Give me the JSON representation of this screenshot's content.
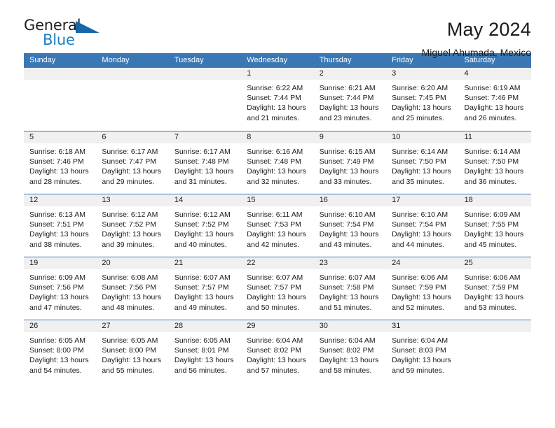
{
  "brand": {
    "word_one": "General",
    "word_two": "Blue",
    "triangle_icon": "triangle-icon"
  },
  "header": {
    "title": "May 2024",
    "subtitle": "Miguel Ahumada, Mexico"
  },
  "theme": {
    "accent": "#3a78b5",
    "brand_blue": "#1b7fc4",
    "daynum_bg": "#f0f0f0",
    "text": "#1a1a1a"
  },
  "weekday_headers": [
    "Sunday",
    "Monday",
    "Tuesday",
    "Wednesday",
    "Thursday",
    "Friday",
    "Saturday"
  ],
  "labels": {
    "sunrise_prefix": "Sunrise:",
    "sunset_prefix": "Sunset:",
    "daylight_prefix": "Daylight:"
  },
  "weeks": [
    [
      {
        "day": "",
        "empty": true
      },
      {
        "day": "",
        "empty": true
      },
      {
        "day": "",
        "empty": true
      },
      {
        "day": "1",
        "sunrise": "Sunrise: 6:22 AM",
        "sunset": "Sunset: 7:44 PM",
        "daylight_line1": "Daylight: 13 hours",
        "daylight_line2": "and 21 minutes."
      },
      {
        "day": "2",
        "sunrise": "Sunrise: 6:21 AM",
        "sunset": "Sunset: 7:44 PM",
        "daylight_line1": "Daylight: 13 hours",
        "daylight_line2": "and 23 minutes."
      },
      {
        "day": "3",
        "sunrise": "Sunrise: 6:20 AM",
        "sunset": "Sunset: 7:45 PM",
        "daylight_line1": "Daylight: 13 hours",
        "daylight_line2": "and 25 minutes."
      },
      {
        "day": "4",
        "sunrise": "Sunrise: 6:19 AM",
        "sunset": "Sunset: 7:46 PM",
        "daylight_line1": "Daylight: 13 hours",
        "daylight_line2": "and 26 minutes."
      }
    ],
    [
      {
        "day": "5",
        "sunrise": "Sunrise: 6:18 AM",
        "sunset": "Sunset: 7:46 PM",
        "daylight_line1": "Daylight: 13 hours",
        "daylight_line2": "and 28 minutes."
      },
      {
        "day": "6",
        "sunrise": "Sunrise: 6:17 AM",
        "sunset": "Sunset: 7:47 PM",
        "daylight_line1": "Daylight: 13 hours",
        "daylight_line2": "and 29 minutes."
      },
      {
        "day": "7",
        "sunrise": "Sunrise: 6:17 AM",
        "sunset": "Sunset: 7:48 PM",
        "daylight_line1": "Daylight: 13 hours",
        "daylight_line2": "and 31 minutes."
      },
      {
        "day": "8",
        "sunrise": "Sunrise: 6:16 AM",
        "sunset": "Sunset: 7:48 PM",
        "daylight_line1": "Daylight: 13 hours",
        "daylight_line2": "and 32 minutes."
      },
      {
        "day": "9",
        "sunrise": "Sunrise: 6:15 AM",
        "sunset": "Sunset: 7:49 PM",
        "daylight_line1": "Daylight: 13 hours",
        "daylight_line2": "and 33 minutes."
      },
      {
        "day": "10",
        "sunrise": "Sunrise: 6:14 AM",
        "sunset": "Sunset: 7:50 PM",
        "daylight_line1": "Daylight: 13 hours",
        "daylight_line2": "and 35 minutes."
      },
      {
        "day": "11",
        "sunrise": "Sunrise: 6:14 AM",
        "sunset": "Sunset: 7:50 PM",
        "daylight_line1": "Daylight: 13 hours",
        "daylight_line2": "and 36 minutes."
      }
    ],
    [
      {
        "day": "12",
        "sunrise": "Sunrise: 6:13 AM",
        "sunset": "Sunset: 7:51 PM",
        "daylight_line1": "Daylight: 13 hours",
        "daylight_line2": "and 38 minutes."
      },
      {
        "day": "13",
        "sunrise": "Sunrise: 6:12 AM",
        "sunset": "Sunset: 7:52 PM",
        "daylight_line1": "Daylight: 13 hours",
        "daylight_line2": "and 39 minutes."
      },
      {
        "day": "14",
        "sunrise": "Sunrise: 6:12 AM",
        "sunset": "Sunset: 7:52 PM",
        "daylight_line1": "Daylight: 13 hours",
        "daylight_line2": "and 40 minutes."
      },
      {
        "day": "15",
        "sunrise": "Sunrise: 6:11 AM",
        "sunset": "Sunset: 7:53 PM",
        "daylight_line1": "Daylight: 13 hours",
        "daylight_line2": "and 42 minutes."
      },
      {
        "day": "16",
        "sunrise": "Sunrise: 6:10 AM",
        "sunset": "Sunset: 7:54 PM",
        "daylight_line1": "Daylight: 13 hours",
        "daylight_line2": "and 43 minutes."
      },
      {
        "day": "17",
        "sunrise": "Sunrise: 6:10 AM",
        "sunset": "Sunset: 7:54 PM",
        "daylight_line1": "Daylight: 13 hours",
        "daylight_line2": "and 44 minutes."
      },
      {
        "day": "18",
        "sunrise": "Sunrise: 6:09 AM",
        "sunset": "Sunset: 7:55 PM",
        "daylight_line1": "Daylight: 13 hours",
        "daylight_line2": "and 45 minutes."
      }
    ],
    [
      {
        "day": "19",
        "sunrise": "Sunrise: 6:09 AM",
        "sunset": "Sunset: 7:56 PM",
        "daylight_line1": "Daylight: 13 hours",
        "daylight_line2": "and 47 minutes."
      },
      {
        "day": "20",
        "sunrise": "Sunrise: 6:08 AM",
        "sunset": "Sunset: 7:56 PM",
        "daylight_line1": "Daylight: 13 hours",
        "daylight_line2": "and 48 minutes."
      },
      {
        "day": "21",
        "sunrise": "Sunrise: 6:07 AM",
        "sunset": "Sunset: 7:57 PM",
        "daylight_line1": "Daylight: 13 hours",
        "daylight_line2": "and 49 minutes."
      },
      {
        "day": "22",
        "sunrise": "Sunrise: 6:07 AM",
        "sunset": "Sunset: 7:57 PM",
        "daylight_line1": "Daylight: 13 hours",
        "daylight_line2": "and 50 minutes."
      },
      {
        "day": "23",
        "sunrise": "Sunrise: 6:07 AM",
        "sunset": "Sunset: 7:58 PM",
        "daylight_line1": "Daylight: 13 hours",
        "daylight_line2": "and 51 minutes."
      },
      {
        "day": "24",
        "sunrise": "Sunrise: 6:06 AM",
        "sunset": "Sunset: 7:59 PM",
        "daylight_line1": "Daylight: 13 hours",
        "daylight_line2": "and 52 minutes."
      },
      {
        "day": "25",
        "sunrise": "Sunrise: 6:06 AM",
        "sunset": "Sunset: 7:59 PM",
        "daylight_line1": "Daylight: 13 hours",
        "daylight_line2": "and 53 minutes."
      }
    ],
    [
      {
        "day": "26",
        "sunrise": "Sunrise: 6:05 AM",
        "sunset": "Sunset: 8:00 PM",
        "daylight_line1": "Daylight: 13 hours",
        "daylight_line2": "and 54 minutes."
      },
      {
        "day": "27",
        "sunrise": "Sunrise: 6:05 AM",
        "sunset": "Sunset: 8:00 PM",
        "daylight_line1": "Daylight: 13 hours",
        "daylight_line2": "and 55 minutes."
      },
      {
        "day": "28",
        "sunrise": "Sunrise: 6:05 AM",
        "sunset": "Sunset: 8:01 PM",
        "daylight_line1": "Daylight: 13 hours",
        "daylight_line2": "and 56 minutes."
      },
      {
        "day": "29",
        "sunrise": "Sunrise: 6:04 AM",
        "sunset": "Sunset: 8:02 PM",
        "daylight_line1": "Daylight: 13 hours",
        "daylight_line2": "and 57 minutes."
      },
      {
        "day": "30",
        "sunrise": "Sunrise: 6:04 AM",
        "sunset": "Sunset: 8:02 PM",
        "daylight_line1": "Daylight: 13 hours",
        "daylight_line2": "and 58 minutes."
      },
      {
        "day": "31",
        "sunrise": "Sunrise: 6:04 AM",
        "sunset": "Sunset: 8:03 PM",
        "daylight_line1": "Daylight: 13 hours",
        "daylight_line2": "and 59 minutes."
      },
      {
        "day": "",
        "empty": true
      }
    ]
  ]
}
